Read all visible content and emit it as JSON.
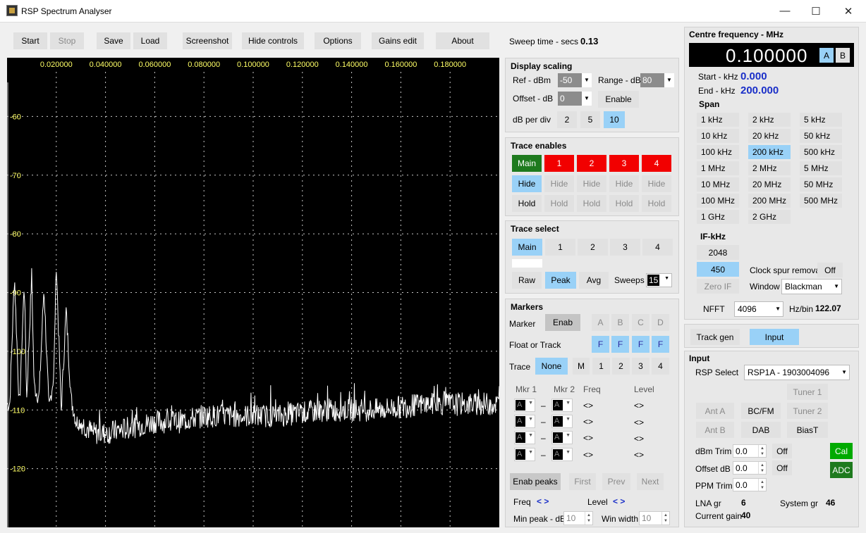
{
  "window": {
    "title": "RSP Spectrum Analyser",
    "minimize": "—",
    "maximize": "☐",
    "close": "✕"
  },
  "toolbar": {
    "start": "Start",
    "stop": "Stop",
    "save": "Save",
    "load": "Load",
    "screenshot": "Screenshot",
    "hide_controls": "Hide controls",
    "options": "Options",
    "gains_edit": "Gains edit",
    "about": "About",
    "sweep_label": "Sweep time - secs",
    "sweep_value": "0.13"
  },
  "plot": {
    "x_ticks": [
      "0.020000",
      "0.040000",
      "0.060000",
      "0.080000",
      "0.100000",
      "0.120000",
      "0.140000",
      "0.160000",
      "0.180000"
    ],
    "y_ticks": [
      "-60",
      "-70",
      "-80",
      "-90",
      "-100",
      "-110",
      "-120"
    ]
  },
  "chart_data": {
    "type": "line",
    "x_range": [
      0,
      0.2
    ],
    "y_range": [
      -50,
      -130
    ],
    "grid": true,
    "series": [
      {
        "x": [
          0.001,
          0.003,
          0.005,
          0.007,
          0.008,
          0.01,
          0.011,
          0.013,
          0.015,
          0.017,
          0.019,
          0.02,
          0.022,
          0.024,
          0.026,
          0.028,
          0.03,
          0.035,
          0.04,
          0.05,
          0.06,
          0.07,
          0.08,
          0.09,
          0.1,
          0.11,
          0.12,
          0.13,
          0.14,
          0.15,
          0.16,
          0.17,
          0.18,
          0.19,
          0.2
        ],
        "y": [
          -110,
          -87,
          -110,
          -88,
          -108,
          -87,
          -106,
          -108,
          -89,
          -110,
          -104,
          -85,
          -110,
          -93,
          -108,
          -112,
          -112,
          -114,
          -114,
          -113,
          -112,
          -112,
          -111,
          -111,
          -111,
          -111,
          -110.5,
          -110,
          -110,
          -110,
          -109.5,
          -109,
          -109,
          -109,
          -109
        ]
      }
    ]
  },
  "display_scaling": {
    "title": "Display scaling",
    "ref_label": "Ref - dBm",
    "ref_value": "-50",
    "range_label": "Range - dB",
    "range_value": "80",
    "offset_label": "Offset - dB",
    "offset_value": "0",
    "enable": "Enable",
    "dbdiv_label": "dB per div",
    "dbdiv": [
      "2",
      "5",
      "10"
    ]
  },
  "trace_enables": {
    "title": "Trace enables",
    "traces": [
      "Main",
      "1",
      "2",
      "3",
      "4"
    ],
    "hide": "Hide",
    "hold": "Hold"
  },
  "trace_select": {
    "title": "Trace select",
    "traces": [
      "Main",
      "1",
      "2",
      "3",
      "4"
    ],
    "raw": "Raw",
    "peak": "Peak",
    "avg": "Avg",
    "sweeps_label": "Sweeps",
    "sweeps_value": "15"
  },
  "markers": {
    "title": "Markers",
    "marker_label": "Marker",
    "enab": "Enab",
    "letters": [
      "A",
      "B",
      "C",
      "D"
    ],
    "float_label": "Float or Track",
    "f": "F",
    "trace_label": "Trace",
    "none": "None",
    "m": "M",
    "nums": [
      "1",
      "2",
      "3",
      "4"
    ],
    "mkr1": "Mkr 1",
    "mkr2": "Mkr 2",
    "freq": "Freq",
    "level": "Level",
    "a": "A",
    "dash": "–",
    "arrows": "<>",
    "enab_peaks": "Enab peaks",
    "first": "First",
    "prev": "Prev",
    "next": "Next",
    "freq_label": "Freq",
    "freq_val": "< >",
    "level_label": "Level",
    "level_val": "< >",
    "minpeak_label": "Min peak - dB",
    "minpeak_value": "10",
    "winwidth_label": "Win width",
    "winwidth_value": "10"
  },
  "centre": {
    "title": "Centre frequency - MHz",
    "value": "0.100000",
    "a": "A",
    "b": "B",
    "start_label": "Start - kHz",
    "start_value": "0.000",
    "end_label": "End - kHz",
    "end_value": "200.000",
    "span_label": "Span",
    "spans": [
      "1 kHz",
      "2 kHz",
      "5 kHz",
      "10 kHz",
      "20 kHz",
      "50 kHz",
      "100 kHz",
      "200 kHz",
      "500 kHz",
      "1 MHz",
      "2 MHz",
      "5 MHz",
      "10 MHz",
      "20 MHz",
      "50 MHz",
      "100 MHz",
      "200 MHz",
      "500 MHz",
      "1 GHz",
      "2 GHz"
    ],
    "if_label": "IF-kHz",
    "if_2048": "2048",
    "if_450": "450",
    "zero_if": "Zero IF",
    "clock_label": "Clock spur removal",
    "clock_value": "Off",
    "window_label": "Window",
    "window_value": "Blackman",
    "nfft_label": "NFFT",
    "nfft_value": "4096",
    "hzbin_label": "Hz/bin",
    "hzbin_value": "122.07"
  },
  "tabs": {
    "track_gen": "Track gen",
    "input": "Input"
  },
  "input": {
    "title": "Input",
    "rsp_label": "RSP Select",
    "rsp_value": "RSP1A - 1903004096",
    "tuner1": "Tuner 1",
    "tuner2": "Tuner 2",
    "ant_a": "Ant A",
    "ant_b": "Ant B",
    "bcfm": "BC/FM",
    "dab": "DAB",
    "biast": "BiasT",
    "dbm_trim_label": "dBm Trim",
    "dbm_trim_value": "0.0",
    "offset_label": "Offset dB",
    "offset_value": "0.0",
    "ppm_label": "PPM Trim",
    "ppm_value": "0.0",
    "off": "Off",
    "cal": "Cal",
    "adc": "ADC",
    "lna_label": "LNA gr",
    "lna_value": "6",
    "system_label": "System gr",
    "system_value": "46",
    "current_label": "Current gain",
    "current_value": "40"
  }
}
